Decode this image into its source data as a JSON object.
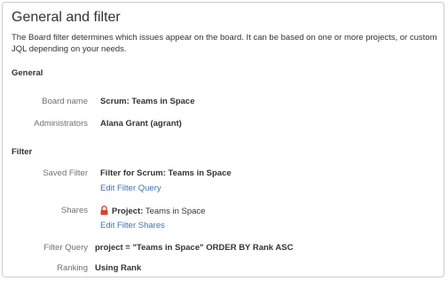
{
  "title": "General and filter",
  "description": "The Board filter determines which issues appear on the board. It can be based on one or more projects, or custom JQL depending on your needs.",
  "general": {
    "heading": "General",
    "board_name_label": "Board name",
    "board_name_value": "Scrum: Teams in Space",
    "administrators_label": "Administrators",
    "administrators_value": "Alana Grant (agrant)"
  },
  "filter": {
    "heading": "Filter",
    "saved_filter_label": "Saved Filter",
    "saved_filter_value": "Filter for Scrum: Teams in Space",
    "edit_filter_query_link": "Edit Filter Query",
    "shares_label": "Shares",
    "shares_prefix": "Project:",
    "shares_value": "Teams in Space",
    "shares_icon": "lock-icon",
    "edit_filter_shares_link": "Edit Filter Shares",
    "filter_query_label": "Filter Query",
    "filter_query_value": "project = \"Teams in Space\" ORDER BY Rank ASC",
    "ranking_label": "Ranking",
    "ranking_value": "Using Rank"
  },
  "colors": {
    "link": "#3b73af",
    "label": "#707070",
    "lock": "#d04437"
  }
}
